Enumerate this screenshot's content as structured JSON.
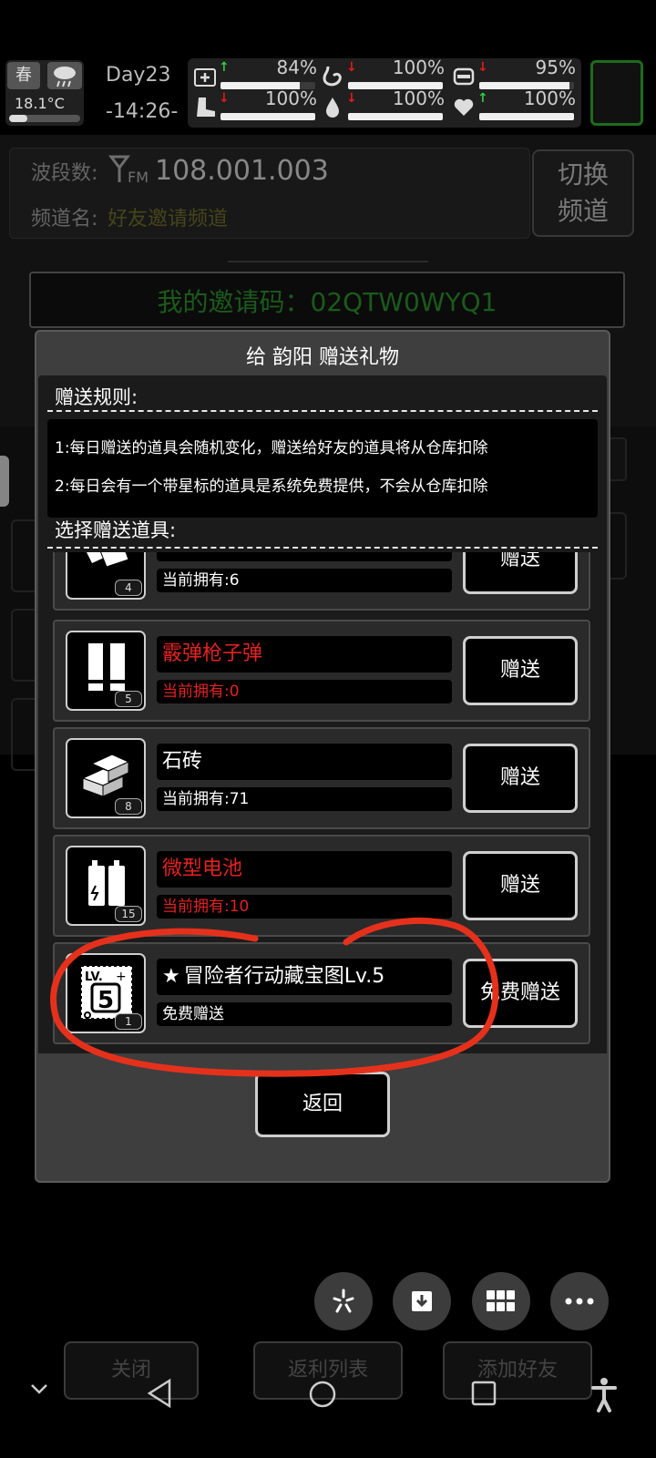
{
  "status": {
    "season": "春",
    "temperature": "18.1°C",
    "day": "Day23",
    "time": "-14:26-",
    "stats_row1": [
      {
        "icon": "medkit-icon",
        "trend": "up",
        "value": "84%",
        "fill": 0.84
      },
      {
        "icon": "stomach-icon",
        "trend": "down",
        "value": "100%",
        "fill": 1.0
      },
      {
        "icon": "battery-icon",
        "trend": "down",
        "value": "95%",
        "fill": 0.95
      }
    ],
    "stats_row2": [
      {
        "icon": "boot-icon",
        "trend": "down",
        "value": "100%",
        "fill": 1.0
      },
      {
        "icon": "water-drop-icon",
        "trend": "down",
        "value": "100%",
        "fill": 1.0
      },
      {
        "icon": "heart-icon",
        "trend": "up",
        "value": "100%",
        "fill": 1.0
      }
    ]
  },
  "radio": {
    "band_label": "波段数:",
    "fm_label": "FM",
    "frequency": "108.001.003",
    "channel_label": "频道名:",
    "channel_name": "好友邀请频道",
    "switch_button": "切换\n频道",
    "invite_code": "我的邀请码：02QTW0WYQ1"
  },
  "dialog": {
    "title": "给 韵阳 赠送礼物",
    "rules_title": "赠送规则:",
    "rules": [
      "1:每日赠送的道具会随机变化，赠送给好友的道具将从仓库扣除",
      "2:每日会有一个带星标的道具是系统免费提供，不会从仓库扣除"
    ],
    "select_title": "选择赠送道具:",
    "items": [
      {
        "name": "(partially hidden)",
        "owned": "当前拥有:6",
        "level": "4",
        "button": "赠送",
        "color": "white",
        "icon": "paper-icon"
      },
      {
        "name": "霰弹枪子弹",
        "owned": "当前拥有:0",
        "level": "5",
        "button": "赠送",
        "color": "red",
        "icon": "shotgun-shell-icon"
      },
      {
        "name": "石砖",
        "owned": "当前拥有:71",
        "level": "8",
        "button": "赠送",
        "color": "white",
        "icon": "brick-icon"
      },
      {
        "name": "微型电池",
        "owned": "当前拥有:10",
        "level": "15",
        "button": "赠送",
        "color": "red",
        "icon": "battery-cell-icon"
      },
      {
        "name": "冒险者行动藏宝图Lv.5",
        "owned": "免费赠送",
        "level": "1",
        "button": "免费赠送",
        "color": "white",
        "icon": "treasure-map-lv5-icon",
        "starred": true
      }
    ],
    "back_button": "返回"
  },
  "background_buttons": {
    "close": "关闭",
    "rebate_list": "返利列表",
    "add_friend": "添加好友"
  },
  "colors": {
    "red_text": "#e32222",
    "green_text": "#2a8a2a",
    "olive_text": "#6b6b2a",
    "annotation": "#e5311c"
  }
}
